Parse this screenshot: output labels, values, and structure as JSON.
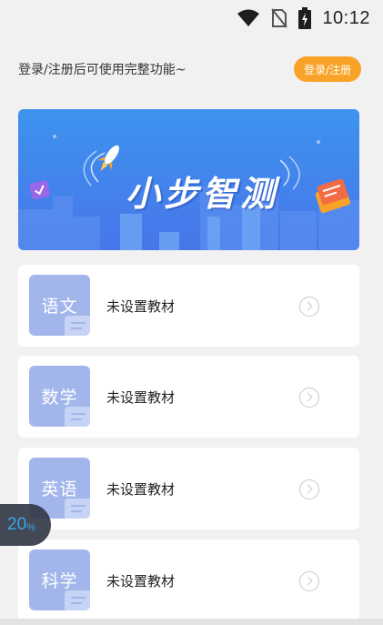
{
  "status_bar": {
    "time": "10:12",
    "icons": [
      "wifi-icon",
      "no-sim-icon",
      "battery-charging-icon"
    ]
  },
  "login": {
    "hint": "登录/注册后可使用完整功能~",
    "button_label": "登录/注册"
  },
  "banner": {
    "title": "小步智测",
    "colors": {
      "top": "#3d93ee",
      "bottom": "#4876ea"
    }
  },
  "subjects": [
    {
      "name": "语文",
      "status": "未设置教材"
    },
    {
      "name": "数学",
      "status": "未设置教材"
    },
    {
      "name": "英语",
      "status": "未设置教材"
    },
    {
      "name": "科学",
      "status": "未设置教材"
    }
  ],
  "progress_badge": {
    "value": "20",
    "unit": "%"
  },
  "colors": {
    "accent_orange": "#f8a327",
    "cover_blue": "#a3b6ec",
    "background": "#f1f1f1"
  }
}
